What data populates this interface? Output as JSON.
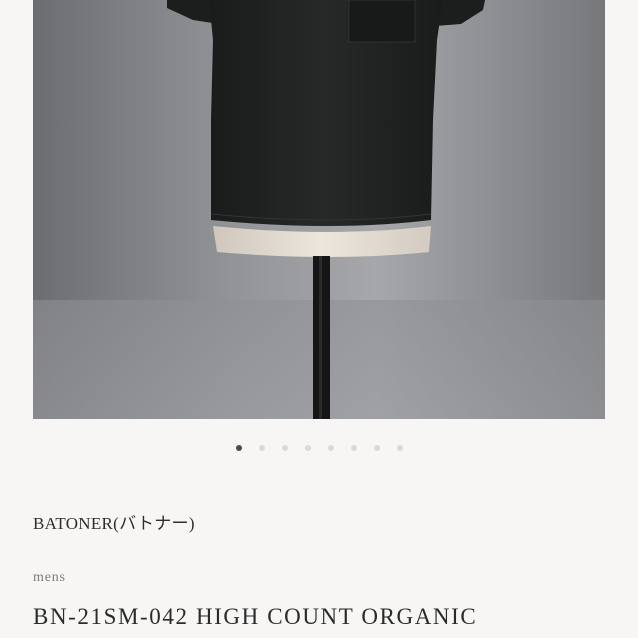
{
  "product": {
    "image_alt": "black short sleeve pocket t-shirt on mannequin",
    "brand": "BATONER(バトナー)",
    "category": "mens",
    "title": "BN-21SM-042 HIGH COUNT ORGANIC"
  },
  "carousel": {
    "total_slides": 8,
    "active_index": 0
  },
  "colors": {
    "active_dot": "#4a4a4a",
    "inactive_dot": "#d9d9d9",
    "shirt": "#1f2020",
    "background": "#f7f6f5"
  },
  "icons": {
    "dot": "carousel-dot-icon"
  }
}
